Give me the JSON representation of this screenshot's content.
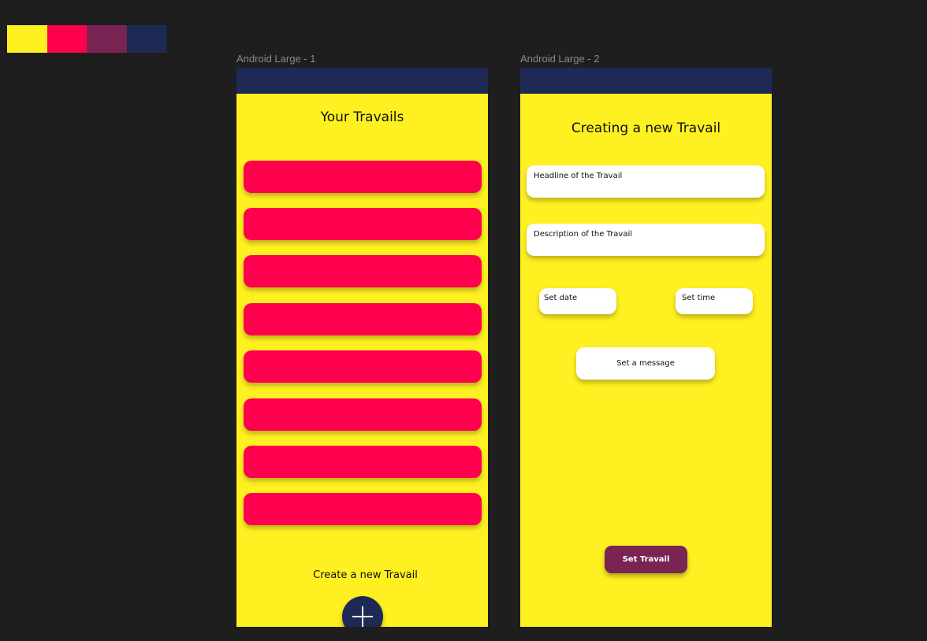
{
  "colors": {
    "yellow": "#fff021",
    "red": "#ff004e",
    "plum": "#7a2454",
    "navy": "#1e2a55",
    "white": "#ffffff"
  },
  "palette": [
    "#fff021",
    "#ff004e",
    "#7a2454",
    "#1e2a55"
  ],
  "frame1": {
    "label": "Android Large - 1",
    "title": "Your Travails",
    "list_item_count": 8,
    "create_label": "Create a new Travail",
    "fab_icon": "plus-icon"
  },
  "frame2": {
    "label": "Android Large - 2",
    "title": "Creating a new Travail",
    "headline_placeholder": "Headline of the Travail",
    "description_placeholder": "Description of the Travail",
    "set_date": "Set date",
    "set_time": "Set time",
    "set_message": "Set a message",
    "submit_label": "Set Travail"
  }
}
